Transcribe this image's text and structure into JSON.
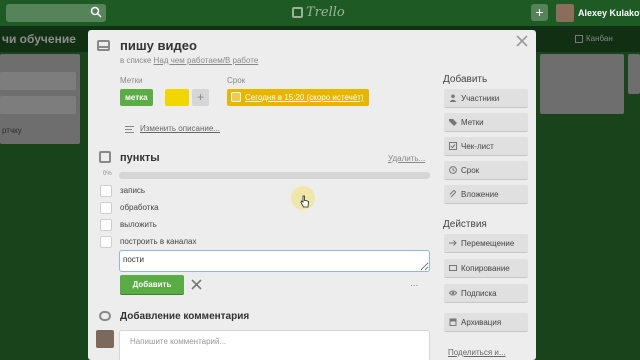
{
  "topbar": {
    "logo_text": "Trello",
    "user_name": "Alexey Kulakov"
  },
  "board": {
    "title": "чи обучение",
    "right_link": "Канбан",
    "left_card_text": "ртчку"
  },
  "card": {
    "title": "пишу видео",
    "in_list_prefix": "в списке",
    "list_name": "Над чем работаем/В работе",
    "labels_heading": "Метки",
    "due_heading": "Срок",
    "label_name": "метка",
    "label_color_green": "#5aac44",
    "label_color_yellow": "#f2d600",
    "add_label_symbol": "+",
    "due_text": "Сегодня в 15:20 (скоро истечёт)",
    "due_color": "#e8b600",
    "edit_description": "Изменить описание..."
  },
  "checklist": {
    "title": "пункты",
    "delete_label": "Удалить...",
    "progress_label": "0%",
    "progress_fraction": 0,
    "items": [
      {
        "text": "запись",
        "checked": false
      },
      {
        "text": "обработка",
        "checked": false
      },
      {
        "text": "выложить",
        "checked": false
      },
      {
        "text": "построить в каналах",
        "checked": false
      }
    ],
    "new_item_value": "пости",
    "add_button": "Добавить",
    "more_symbol": "..."
  },
  "comment": {
    "title": "Добавление комментария",
    "placeholder": "Напишите комментарий..."
  },
  "sidebar": {
    "add_heading": "Добавить",
    "add_buttons": [
      {
        "label": "Участники",
        "icon": "person-icon"
      },
      {
        "label": "Метки",
        "icon": "tag-icon"
      },
      {
        "label": "Чек-лист",
        "icon": "checklist-icon"
      },
      {
        "label": "Срок",
        "icon": "clock-icon"
      },
      {
        "label": "Вложение",
        "icon": "paperclip-icon"
      }
    ],
    "actions_heading": "Действия",
    "action_buttons": [
      {
        "label": "Перемещение",
        "icon": "arrow-right-icon"
      },
      {
        "label": "Копирование",
        "icon": "copy-icon"
      },
      {
        "label": "Подписка",
        "icon": "eye-icon"
      },
      {
        "label": "Архивация",
        "icon": "archive-icon"
      }
    ],
    "share_link": "Поделиться и..."
  }
}
